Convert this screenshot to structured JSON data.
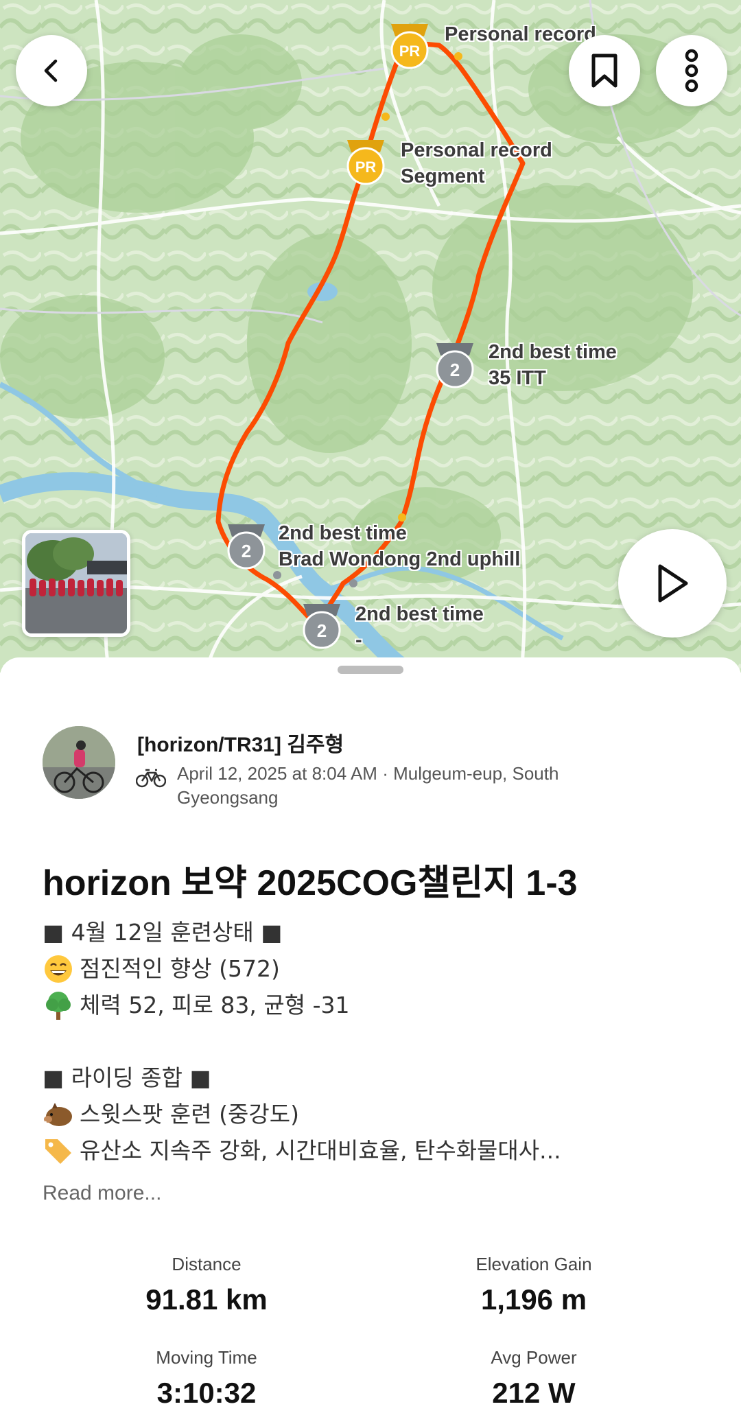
{
  "map": {
    "segments": [
      {
        "id": "seg-pr-1",
        "badge": "PR",
        "line1": "Personal record",
        "line2": ""
      },
      {
        "id": "seg-pr-2",
        "badge": "PR",
        "line1": "Personal record",
        "line2": "Segment"
      },
      {
        "id": "seg-2nd-1",
        "badge": "2",
        "line1": "2nd best time",
        "line2": "35  ITT"
      },
      {
        "id": "seg-2nd-2",
        "badge": "2",
        "line1": "2nd best time",
        "line2": "Brad Wondong 2nd uphill"
      },
      {
        "id": "seg-2nd-3",
        "badge": "2",
        "line1": "2nd best time",
        "line2": "-"
      }
    ],
    "route_color": "#fc4c02",
    "icons": {
      "back": "chevron-left-icon",
      "bookmark": "bookmark-icon",
      "more": "more-vertical-icon",
      "play": "play-icon"
    }
  },
  "activity": {
    "athlete_name": "[horizon/TR31] 김주형",
    "meta": "April 12, 2025 at 8:04 AM · Mulgeum-eup, South Gyeongsang",
    "sport_icon": "bike-icon",
    "title": "horizon 보약 2025COG챌린지 1-3",
    "description": [
      {
        "emoji": "",
        "text": "■ 4월 12일 훈련상태 ■"
      },
      {
        "emoji": "grinning-face-icon",
        "text": "점진적인 향상 (572)"
      },
      {
        "emoji": "tree-icon",
        "text": "체력 52, 피로 83, 균형 -31"
      },
      {
        "emoji": "",
        "text": ""
      },
      {
        "emoji": "",
        "text": "■ 라이딩 종합 ■"
      },
      {
        "emoji": "boar-icon",
        "text": "스윗스팟 훈련 (중강도)"
      },
      {
        "emoji": "tag-icon",
        "text": "유산소 지속주 강화, 시간대비효율, 탄수화물대사..."
      }
    ],
    "read_more": "Read more...",
    "stats": {
      "distance": {
        "label": "Distance",
        "value": "91.81 km"
      },
      "elevation": {
        "label": "Elevation Gain",
        "value": "1,196 m"
      },
      "moving_time": {
        "label": "Moving Time",
        "value": "3:10:32"
      },
      "avg_power": {
        "label": "Avg Power",
        "value": "212 W"
      }
    }
  },
  "colors": {
    "accent": "#fc4c02",
    "pr_badge": "#f5b81c",
    "second_badge": "#8e9499"
  }
}
